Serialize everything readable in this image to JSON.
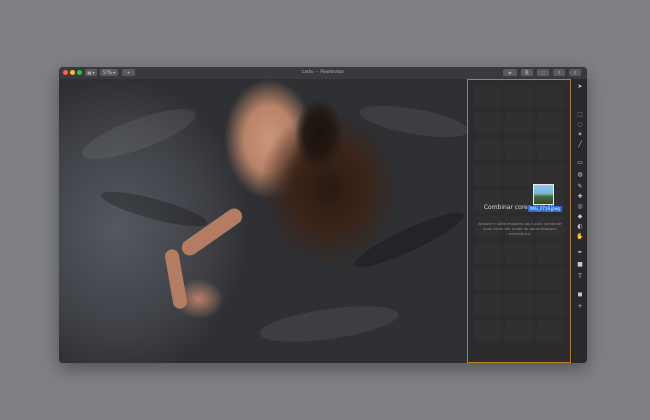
{
  "window": {
    "title_file": "carla",
    "title_separator": "—",
    "title_app": "Pixelmator"
  },
  "toolbar": {
    "view_label": "▦ ▾",
    "zoom_label": "57% ▾",
    "add_label": "+",
    "right_buttons": [
      "⇄",
      "⎘",
      "⬚",
      "⇪",
      "⇧"
    ]
  },
  "panel": {
    "title": "Combinar cores com ML",
    "description": "Arraste e solte imagens aqui para combinar suas cores em modo de aprendizagem automático.",
    "dragged_file": "IMG_2719.jpeg"
  },
  "tools": [
    {
      "name": "arrange-tool-icon",
      "glyph": "➤"
    },
    {
      "name": "selection-tool-icon",
      "glyph": "⬚"
    },
    {
      "name": "lasso-tool-icon",
      "glyph": "◌"
    },
    {
      "name": "magic-wand-tool-icon",
      "glyph": "✶"
    },
    {
      "name": "paint-tool-icon",
      "glyph": "╱"
    },
    {
      "name": "eraser-tool-icon",
      "glyph": "▭"
    },
    {
      "name": "fill-tool-icon",
      "glyph": "◍"
    },
    {
      "name": "retouch-tool-icon",
      "glyph": "✎"
    },
    {
      "name": "repair-tool-icon",
      "glyph": "✚"
    },
    {
      "name": "clone-tool-icon",
      "glyph": "◎"
    },
    {
      "name": "sharpen-tool-icon",
      "glyph": "◆"
    },
    {
      "name": "color-adjust-tool-icon",
      "glyph": "◐"
    },
    {
      "name": "warp-tool-icon",
      "glyph": "✋"
    },
    {
      "name": "pen-tool-icon",
      "glyph": "✒"
    },
    {
      "name": "shape-tool-icon",
      "glyph": "■"
    },
    {
      "name": "type-tool-icon",
      "glyph": "T"
    },
    {
      "name": "color-picker-tool-icon",
      "glyph": "◼"
    },
    {
      "name": "add-tool-icon",
      "glyph": "+"
    }
  ]
}
